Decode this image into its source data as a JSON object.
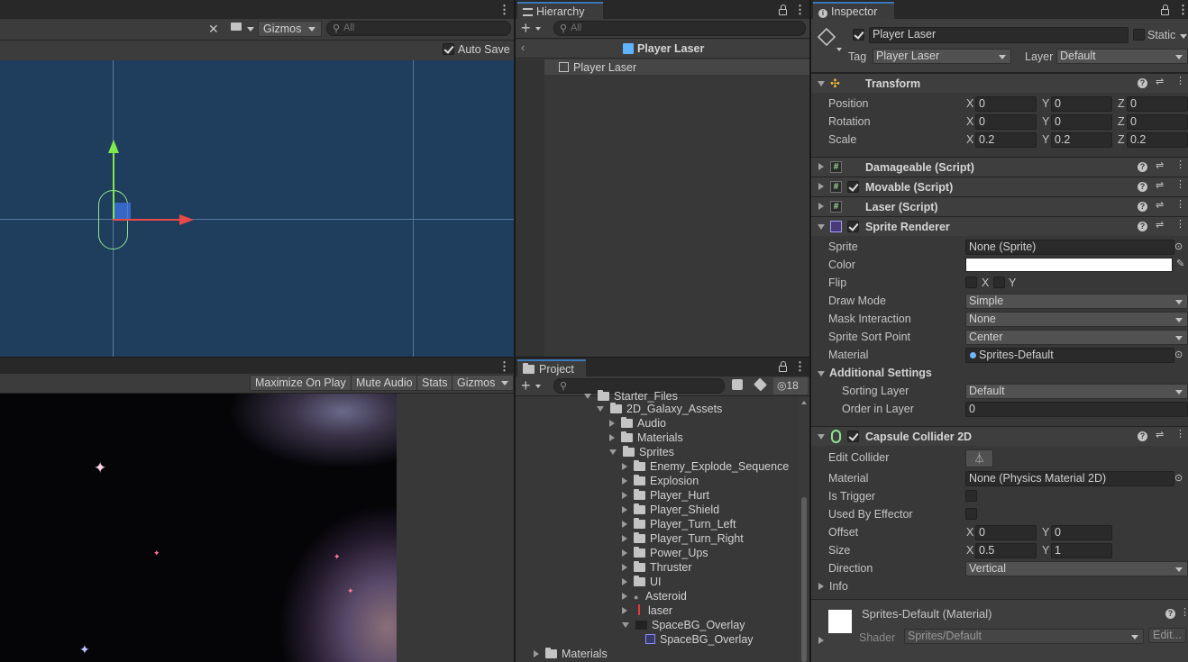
{
  "scene": {
    "gizmos_label": "Gizmos",
    "search_placeholder": "All",
    "autosave_label": "Auto Save",
    "autosave_checked": true
  },
  "game": {
    "maximize_label": "Maximize On Play",
    "mute_label": "Mute Audio",
    "stats_label": "Stats",
    "gizmos_label": "Gizmos"
  },
  "hierarchy": {
    "tab": "Hierarchy",
    "search_placeholder": "All",
    "breadcrumb": "Player Laser",
    "items": [
      {
        "label": "Player Laser"
      }
    ]
  },
  "project": {
    "tab": "Project",
    "hidden_count": "18",
    "items": [
      {
        "label": "Starter_Files"
      },
      {
        "label": "2D_Galaxy_Assets"
      },
      {
        "label": "Audio"
      },
      {
        "label": "Materials"
      },
      {
        "label": "Sprites"
      },
      {
        "label": "Enemy_Explode_Sequence"
      },
      {
        "label": "Explosion"
      },
      {
        "label": "Player_Hurt"
      },
      {
        "label": "Player_Shield"
      },
      {
        "label": "Player_Turn_Left"
      },
      {
        "label": "Player_Turn_Right"
      },
      {
        "label": "Power_Ups"
      },
      {
        "label": "Thruster"
      },
      {
        "label": "UI"
      },
      {
        "label": "Asteroid"
      },
      {
        "label": "laser"
      },
      {
        "label": "SpaceBG_Overlay"
      },
      {
        "label": "SpaceBG_Overlay"
      },
      {
        "label": "Materials"
      }
    ]
  },
  "inspector": {
    "tab": "Inspector",
    "object_name": "Player Laser",
    "static_label": "Static",
    "tag_label": "Tag",
    "tag_value": "Player Laser",
    "layer_label": "Layer",
    "layer_value": "Default",
    "transform": {
      "title": "Transform",
      "position_label": "Position",
      "rotation_label": "Rotation",
      "scale_label": "Scale",
      "position": {
        "x": "0",
        "y": "0",
        "z": "0"
      },
      "rotation": {
        "x": "0",
        "y": "0",
        "z": "0"
      },
      "scale": {
        "x": "0.2",
        "y": "0.2",
        "z": "0.2"
      }
    },
    "axis": {
      "x": "X",
      "y": "Y",
      "z": "Z"
    },
    "damageable": "Damageable (Script)",
    "movable": "Movable (Script)",
    "laser": "Laser (Script)",
    "sprite_renderer": {
      "title": "Sprite Renderer",
      "sprite_label": "Sprite",
      "sprite_value": "None (Sprite)",
      "color_label": "Color",
      "color_value": "#ffffff",
      "flip_label": "Flip",
      "flip_x": "X",
      "flip_y": "Y",
      "draw_mode_label": "Draw Mode",
      "draw_mode_value": "Simple",
      "mask_label": "Mask Interaction",
      "mask_value": "None",
      "sort_point_label": "Sprite Sort Point",
      "sort_point_value": "Center",
      "material_label": "Material",
      "material_value": "Sprites-Default",
      "additional_label": "Additional Settings",
      "sorting_layer_label": "Sorting Layer",
      "sorting_layer_value": "Default",
      "order_label": "Order in Layer",
      "order_value": "0"
    },
    "capsule": {
      "title": "Capsule Collider 2D",
      "edit_label": "Edit Collider",
      "material_label": "Material",
      "material_value": "None (Physics Material 2D)",
      "trigger_label": "Is Trigger",
      "effector_label": "Used By Effector",
      "offset_label": "Offset",
      "offset": {
        "x": "0",
        "y": "0"
      },
      "size_label": "Size",
      "size": {
        "x": "0.5",
        "y": "1"
      },
      "direction_label": "Direction",
      "direction_value": "Vertical",
      "info_label": "Info"
    },
    "material_preview": {
      "name": "Sprites-Default (Material)",
      "shader_label": "Shader",
      "shader_value": "Sprites/Default",
      "edit_label": "Edit..."
    }
  }
}
